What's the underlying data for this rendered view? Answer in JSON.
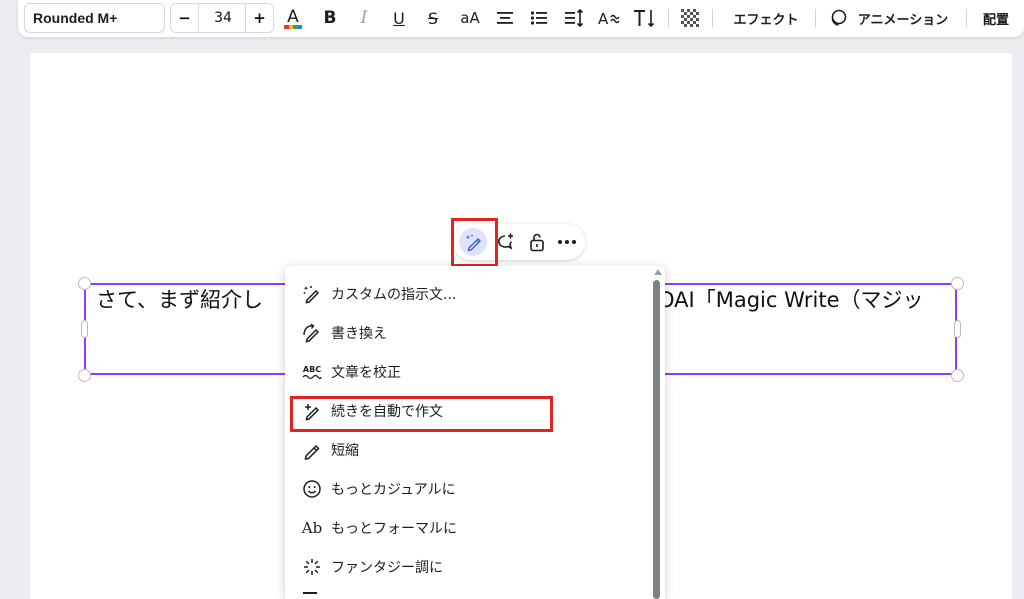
{
  "toolbar": {
    "font_name": "Rounded M+",
    "font_size": "34",
    "minus": "−",
    "plus": "+",
    "effects_label": "エフェクト",
    "animation_label": "アニメーション",
    "arrange_label": "配置",
    "case_label": "aA",
    "bold_label": "B",
    "italic_label": "I",
    "underline_label": "U",
    "strike_label": "S",
    "text_color": "#1a1d22"
  },
  "textbox": {
    "text_left": "さて、まず紹介し",
    "text_right": "OAI「Magic Write（マジッ"
  },
  "menu": {
    "items": [
      {
        "label": "カスタムの指示文...",
        "icon": "magic-pen-sparkle-icon"
      },
      {
        "label": "書き換え",
        "icon": "rewrite-pen-icon"
      },
      {
        "label": "文章を校正",
        "icon": "spellcheck-abc-icon"
      },
      {
        "label": "続きを自動で作文",
        "icon": "continue-writing-pen-icon"
      },
      {
        "label": "短縮",
        "icon": "shorten-pen-icon"
      },
      {
        "label": "もっとカジュアルに",
        "icon": "smiley-icon"
      },
      {
        "label": "もっとフォーマルに",
        "icon": "formal-ab-icon"
      },
      {
        "label": "ファンタジー調に",
        "icon": "fantasy-sparkle-icon"
      }
    ],
    "abc_glyph": "ABC",
    "ab_glyph": "Ab"
  },
  "colors": {
    "accent_purple": "#8b3dff",
    "highlight_red": "#e02424",
    "magic_bg": "#dfe3ff"
  }
}
